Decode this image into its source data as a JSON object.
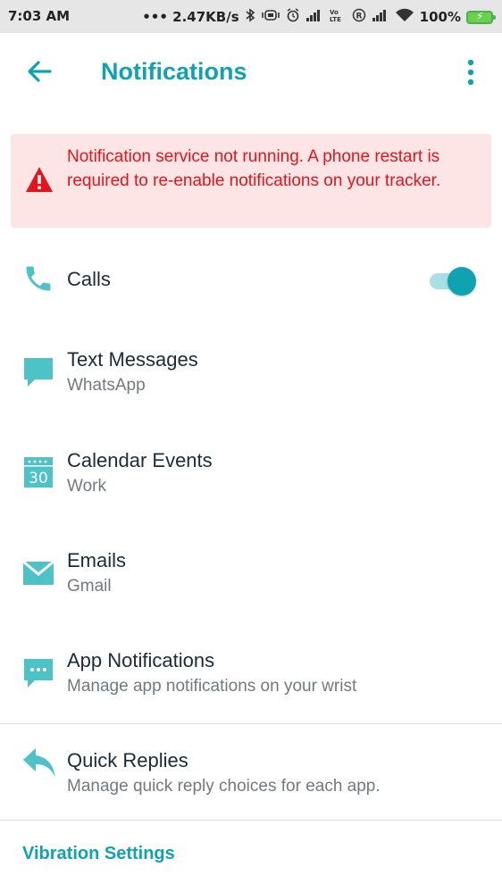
{
  "status_bar": {
    "time": "7:03 AM",
    "speed": "••• 2.47KB/s",
    "battery": "100%"
  },
  "header": {
    "title": "Notifications"
  },
  "alert": {
    "message": "Notification service not running. A phone restart is required to re-enable notifications on your tracker."
  },
  "items": [
    {
      "title": "Calls",
      "icon": "phone-icon",
      "toggle_on": true
    },
    {
      "title": "Text Messages",
      "subtitle": "WhatsApp",
      "icon": "message-icon"
    },
    {
      "title": "Calendar Events",
      "subtitle": "Work",
      "icon": "calendar-icon",
      "calendar_day": "30"
    },
    {
      "title": "Emails",
      "subtitle": "Gmail",
      "icon": "email-icon"
    },
    {
      "title": "App Notifications",
      "subtitle": "Manage app notifications on your wrist",
      "icon": "app-notification-icon"
    },
    {
      "title": "Quick Replies",
      "subtitle": "Manage quick reply choices for each app.",
      "icon": "reply-icon"
    }
  ],
  "footer": {
    "link": "Vibration Settings"
  },
  "colors": {
    "accent": "#0fa3b1",
    "icon": "#4ec3c7",
    "alert_text": "#e3141c",
    "alert_bg": "#fde5e5"
  }
}
